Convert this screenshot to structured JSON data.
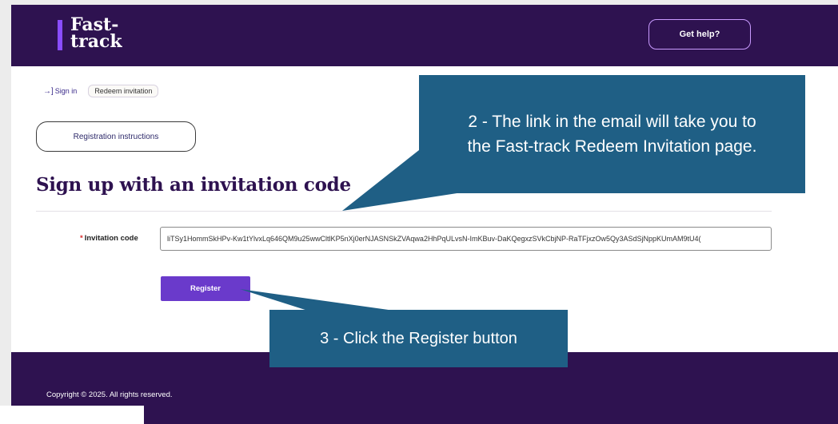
{
  "header": {
    "logo_line1": "Fast-",
    "logo_line2": "track",
    "help_label": "Get help?"
  },
  "breadcrumb": {
    "signin_icon": "→]",
    "signin_label": "Sign in",
    "current_label": "Redeem invitation"
  },
  "main": {
    "instructions_label": "Registration instructions",
    "title": "Sign up with an invitation code",
    "field": {
      "required_marker": "*",
      "label": "Invitation code",
      "value": "liTSy1HommSkHPv-Kw1tYlvxLq646QM9u25wwCltlKP5nXj0erNJASNSkZVAqwa2HhPqULvsN-ImKBuv-DaKQegxzSVkCbjNP-RaTFjxzOw5Qy3ASdSjNppKUmAM9tU4("
    },
    "register_label": "Register"
  },
  "footer": {
    "copyright": "Copyright © 2025. All rights reserved."
  },
  "annotations": {
    "callout_1_line1": "2 - The link in the email will take you to",
    "callout_1_line2": "the Fast-track Redeem Invitation page.",
    "callout_2": "3 - Click the Register button",
    "callout_color": "#1f5f85"
  },
  "colors": {
    "brand_dark": "#2e1250",
    "brand_accent": "#8a4dff",
    "button_purple": "#6a3acb",
    "required_red": "#d92b2b"
  }
}
